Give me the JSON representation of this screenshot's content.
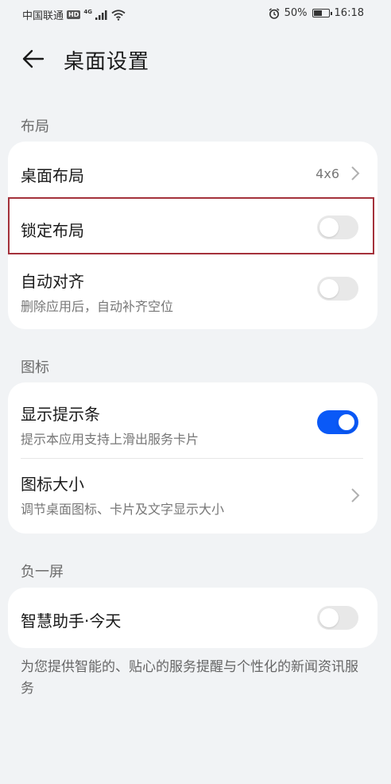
{
  "status_bar": {
    "carrier": "中国联通",
    "hd_badge": "HD",
    "network_type": "4G",
    "battery_percent": "50%",
    "time": "16:18"
  },
  "header": {
    "title": "桌面设置"
  },
  "sections": {
    "layout": {
      "label": "布局",
      "desktop_layout": {
        "title": "桌面布局",
        "value": "4x6"
      },
      "lock_layout": {
        "title": "锁定布局",
        "enabled": false
      },
      "auto_align": {
        "title": "自动对齐",
        "subtitle": "删除应用后，自动补齐空位",
        "enabled": false
      }
    },
    "icons": {
      "label": "图标",
      "show_hint_bar": {
        "title": "显示提示条",
        "subtitle": "提示本应用支持上滑出服务卡片",
        "enabled": true
      },
      "icon_size": {
        "title": "图标大小",
        "subtitle": "调节桌面图标、卡片及文字显示大小"
      }
    },
    "minus_one_screen": {
      "label": "负一屏",
      "smart_assistant": {
        "title": "智慧助手·今天",
        "enabled": false
      },
      "footnote": "为您提供智能的、贴心的服务提醒与个性化的新闻资讯服务"
    }
  },
  "colors": {
    "accent": "#0a59f7",
    "highlight": "#a4313b",
    "background": "#f1f3f5"
  }
}
